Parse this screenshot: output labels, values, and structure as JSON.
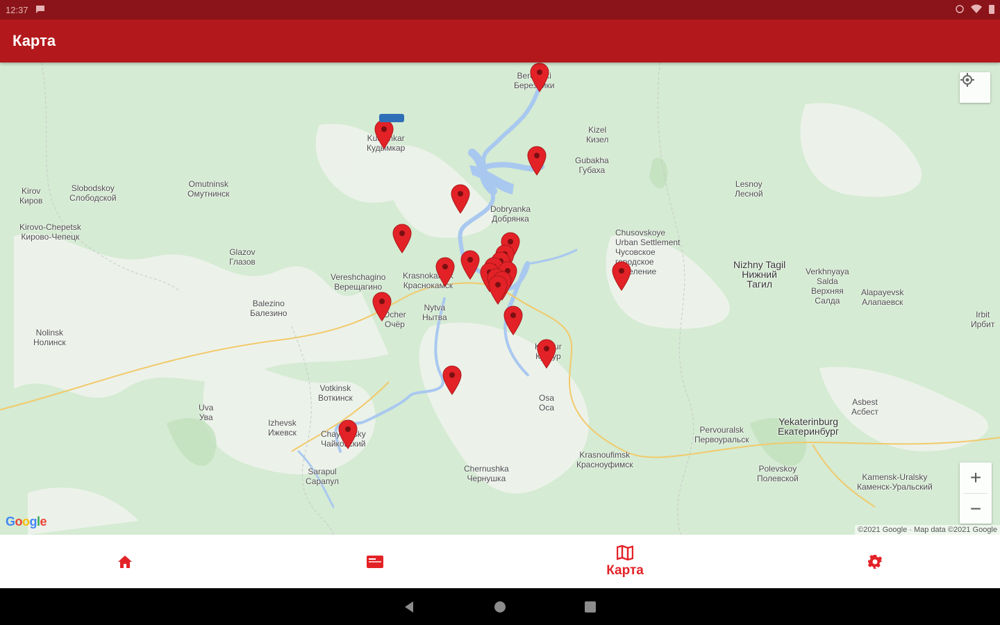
{
  "status_bar": {
    "time": "12:37"
  },
  "app_bar": {
    "title": "Карта"
  },
  "map": {
    "cities": [
      {
        "id": "berezniki",
        "lines": [
          "Berezniki",
          "Березники"
        ]
      },
      {
        "id": "kudymkar",
        "lines": [
          "Kudymkar",
          "Кудымкар"
        ]
      },
      {
        "id": "kirov",
        "lines": [
          "Kirov",
          "Киров"
        ]
      },
      {
        "id": "kirovo-chepetsk",
        "lines": [
          "Kirovo-Chepetsk",
          "Кирово-Чепецк"
        ]
      },
      {
        "id": "glazov",
        "lines": [
          "Glazov",
          "Глазов"
        ]
      },
      {
        "id": "dobryanka",
        "lines": [
          "Dobryanka",
          "Добрянка"
        ]
      },
      {
        "id": "krasnokamsk",
        "lines": [
          "Krasnokamsk",
          "Краснокамск"
        ]
      },
      {
        "id": "nytva",
        "lines": [
          "Nytva",
          "Нытва"
        ]
      },
      {
        "id": "chusovoy",
        "lines": [
          "Chusovskoye",
          "Urban Settlement",
          "Чусовское",
          "городское",
          "поселение"
        ]
      },
      {
        "id": "lesnoy",
        "lines": [
          "Lesnoy",
          "Лесной"
        ]
      },
      {
        "id": "nizhny-tagil",
        "lines": [
          "Nizhny Tagil",
          "Нижний",
          "Тагил"
        ]
      },
      {
        "id": "kungur",
        "lines": [
          "Kungur",
          "Кунгур"
        ]
      },
      {
        "id": "votkinsk",
        "lines": [
          "Votkinsk",
          "Воткинск"
        ]
      },
      {
        "id": "izhevsk",
        "lines": [
          "Izhevsk",
          "Ижевск"
        ]
      },
      {
        "id": "chaykovsky",
        "lines": [
          "Chaykovsky",
          "Чайковский"
        ]
      },
      {
        "id": "sarapul",
        "lines": [
          "Sarapul",
          "Сарапул"
        ]
      },
      {
        "id": "chernushka",
        "lines": [
          "Chernushka",
          "Чернушка"
        ]
      },
      {
        "id": "pervouralsk",
        "lines": [
          "Pervouralsk",
          "Первоуральск"
        ]
      },
      {
        "id": "yekaterinburg",
        "lines": [
          "Yekaterinburg",
          "Екатеринбург"
        ]
      },
      {
        "id": "asbest",
        "lines": [
          "Asbest",
          "Асбест"
        ]
      },
      {
        "id": "polevskoy",
        "lines": [
          "Polevskoy",
          "Полевской"
        ]
      },
      {
        "id": "kamensk",
        "lines": [
          "Kamensk-Uralsky",
          "Каменск-Уральский"
        ]
      },
      {
        "id": "krasnoufimsk",
        "lines": [
          "Krasnoufimsk",
          "Красноуфимск"
        ]
      },
      {
        "id": "gubakha",
        "lines": [
          "Gubakha",
          "Губаха"
        ]
      },
      {
        "id": "kizel",
        "lines": [
          "Kizel",
          "Кизел"
        ]
      },
      {
        "id": "slobodskoy",
        "lines": [
          "Slobodskoy",
          "Слободской"
        ]
      },
      {
        "id": "omutninsk",
        "lines": [
          "Omutninsk",
          "Омутнинск"
        ]
      },
      {
        "id": "irbit",
        "lines": [
          "Irbit",
          "Ирбит"
        ]
      },
      {
        "id": "verkhnyaya-salda",
        "lines": [
          "Verkhnyaya",
          "Salda",
          "Верхняя",
          "Салда"
        ]
      },
      {
        "id": "alapaevsk",
        "lines": [
          "Alapayevsk",
          "Алапаевск"
        ]
      },
      {
        "id": "nolinsk",
        "lines": [
          "Nolinsk",
          "Нолинск"
        ]
      },
      {
        "id": "uva",
        "lines": [
          "Uva",
          "Ува"
        ]
      },
      {
        "id": "balezino",
        "lines": [
          "Balezino",
          "Балезино"
        ]
      },
      {
        "id": "vereshchagino",
        "lines": [
          "Vereshchagino",
          "Верещагино"
        ]
      },
      {
        "id": "osa",
        "lines": [
          "Osa",
          "Оса"
        ]
      },
      {
        "id": "ocher",
        "lines": [
          "Ocher",
          "Очёр"
        ]
      }
    ],
    "pins_count": 26,
    "attribution": "©2021 Google · Map data ©2021 Google",
    "google_logo": "Google",
    "colors": {
      "land": "#d5ebd3",
      "water": "#a9c8f0",
      "pin": "#e32227",
      "road": "#f2c96a"
    }
  },
  "controls": {
    "zoom_in": "+",
    "zoom_out": "−",
    "my_location_icon": "crosshair-icon"
  },
  "bottom_nav": {
    "items": [
      {
        "id": "home",
        "icon": "home-icon",
        "label": ""
      },
      {
        "id": "news",
        "icon": "card-icon",
        "label": ""
      },
      {
        "id": "map",
        "icon": "map-icon",
        "label": "Карта",
        "active": true
      },
      {
        "id": "settings",
        "icon": "gear-icon",
        "label": ""
      }
    ]
  },
  "accent": "#e32227",
  "appbar_color": "#b3191c"
}
